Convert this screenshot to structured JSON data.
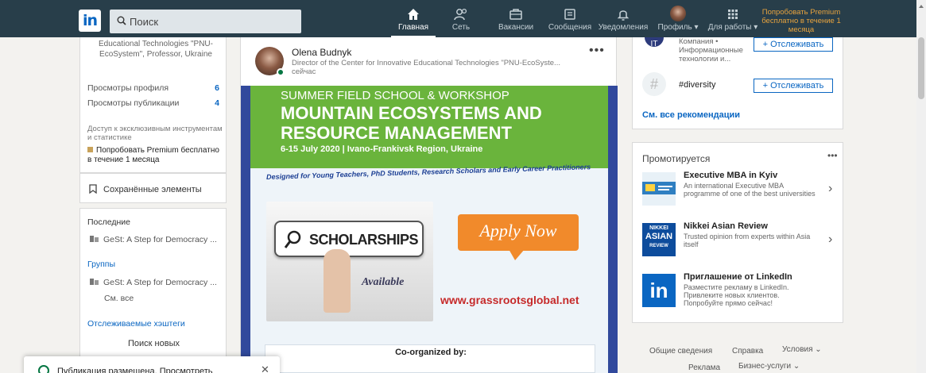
{
  "topbar": {
    "logo": "in",
    "search_placeholder": "Поиск",
    "nav": [
      {
        "label": "Главная",
        "icon": "home-icon"
      },
      {
        "label": "Сеть",
        "icon": "network-icon"
      },
      {
        "label": "Вакансии",
        "icon": "briefcase-icon"
      },
      {
        "label": "Сообщения",
        "icon": "messages-icon"
      },
      {
        "label": "Уведомления",
        "icon": "bell-icon"
      },
      {
        "label": "Профиль ▾",
        "icon": "avatar"
      },
      {
        "label": "Для работы ▾",
        "icon": "grid-icon"
      }
    ],
    "premium": "Попробовать Premium бесплатно в течение 1 месяца"
  },
  "left": {
    "org": "Educational Technologies \"PNU-EcoSystem\", Professor, Ukraine",
    "stats": [
      {
        "label": "Просмотры профиля",
        "value": "6"
      },
      {
        "label": "Просмотры публикации",
        "value": "4"
      }
    ],
    "exclusive": "Доступ к эксклюзивным инструментам и статистике",
    "try_premium": "Попробовать Premium бесплатно в течение 1 месяца",
    "saved": "Сохранённые элементы",
    "recent_head": "Последние",
    "recent_item": "GeSt: A Step for Democracy ...",
    "groups_head": "Группы",
    "group_item": "GeSt: A Step for Democracy ...",
    "see_all": "См. все",
    "hashtags_head": "Отслеживаемые хэштеги",
    "find_new": "Поиск новых"
  },
  "post": {
    "author": "Olena Budnyk",
    "role": "Director of the Center for Innovative Educational Technologies \"PNU-EcoSyste...",
    "time": "сейчас",
    "poster": {
      "line1": "SUMMER FIELD SCHOOL & WORKSHOP",
      "line2": "MOUNTAIN ECOSYSTEMS AND",
      "line3": "RESOURCE MANAGEMENT",
      "line4": "6-15 July 2020 | Ivano-Frankivsk Region, Ukraine",
      "designed": "Designed for Young Teachers, PhD Students, Research Scholars and Early Career Practitioners",
      "scholarships": "SCHOLARSHIPS",
      "available": "Available",
      "apply": "Apply Now",
      "url": "www.grassrootsglobal.net",
      "coorg": "Co-organized by:"
    }
  },
  "right": {
    "company": "Компания • Информационные технологии и...",
    "follow_label": "+ Отслеживать",
    "hashtag": "#diversity",
    "see_all": "См. все рекомендации",
    "promo_head": "Промотируется",
    "ads": [
      {
        "title": "Executive MBA in Kyiv",
        "desc": "An international Executive MBA programme of one of the best universities"
      },
      {
        "title": "Nikkei Asian Review",
        "desc": "Trusted opinion from experts within Asia itself",
        "logo": [
          "NIKKEI",
          "ASIAN",
          "REVIEW"
        ]
      },
      {
        "title": "Приглашение от LinkedIn",
        "desc": "Разместите рекламу в LinkedIn. Привлеките новых клиентов. Попробуйте прямо сейчас!"
      }
    ]
  },
  "footer": {
    "about": "Общие сведения",
    "help": "Справка",
    "terms": "Условия ⌄",
    "ads": "Реклама",
    "business": "Бизнес-услуги ⌄"
  },
  "toast": {
    "message": "Публикация размещена. Просмотреть"
  },
  "colors": {
    "nav_bg": "#283e4a",
    "link": "#0a66c2",
    "premium": "#e7a33e",
    "poster_green": "#6ab43c",
    "apply_orange": "#f18a2b"
  }
}
